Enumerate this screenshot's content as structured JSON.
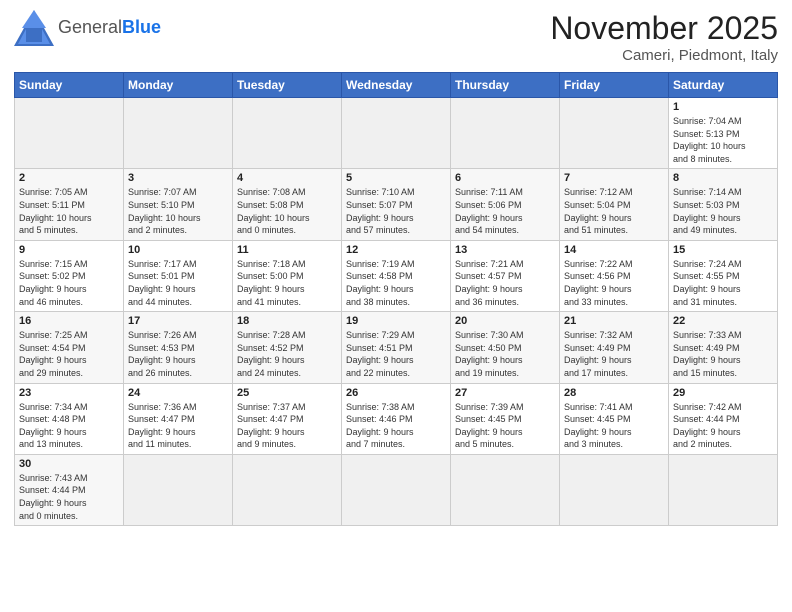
{
  "header": {
    "logo_text_general": "General",
    "logo_text_blue": "Blue",
    "title": "November 2025",
    "location": "Cameri, Piedmont, Italy"
  },
  "weekdays": [
    "Sunday",
    "Monday",
    "Tuesday",
    "Wednesday",
    "Thursday",
    "Friday",
    "Saturday"
  ],
  "weeks": [
    [
      {
        "day": "",
        "info": ""
      },
      {
        "day": "",
        "info": ""
      },
      {
        "day": "",
        "info": ""
      },
      {
        "day": "",
        "info": ""
      },
      {
        "day": "",
        "info": ""
      },
      {
        "day": "",
        "info": ""
      },
      {
        "day": "1",
        "info": "Sunrise: 7:04 AM\nSunset: 5:13 PM\nDaylight: 10 hours\nand 8 minutes."
      }
    ],
    [
      {
        "day": "2",
        "info": "Sunrise: 7:05 AM\nSunset: 5:11 PM\nDaylight: 10 hours\nand 5 minutes."
      },
      {
        "day": "3",
        "info": "Sunrise: 7:07 AM\nSunset: 5:10 PM\nDaylight: 10 hours\nand 2 minutes."
      },
      {
        "day": "4",
        "info": "Sunrise: 7:08 AM\nSunset: 5:08 PM\nDaylight: 10 hours\nand 0 minutes."
      },
      {
        "day": "5",
        "info": "Sunrise: 7:10 AM\nSunset: 5:07 PM\nDaylight: 9 hours\nand 57 minutes."
      },
      {
        "day": "6",
        "info": "Sunrise: 7:11 AM\nSunset: 5:06 PM\nDaylight: 9 hours\nand 54 minutes."
      },
      {
        "day": "7",
        "info": "Sunrise: 7:12 AM\nSunset: 5:04 PM\nDaylight: 9 hours\nand 51 minutes."
      },
      {
        "day": "8",
        "info": "Sunrise: 7:14 AM\nSunset: 5:03 PM\nDaylight: 9 hours\nand 49 minutes."
      }
    ],
    [
      {
        "day": "9",
        "info": "Sunrise: 7:15 AM\nSunset: 5:02 PM\nDaylight: 9 hours\nand 46 minutes."
      },
      {
        "day": "10",
        "info": "Sunrise: 7:17 AM\nSunset: 5:01 PM\nDaylight: 9 hours\nand 44 minutes."
      },
      {
        "day": "11",
        "info": "Sunrise: 7:18 AM\nSunset: 5:00 PM\nDaylight: 9 hours\nand 41 minutes."
      },
      {
        "day": "12",
        "info": "Sunrise: 7:19 AM\nSunset: 4:58 PM\nDaylight: 9 hours\nand 38 minutes."
      },
      {
        "day": "13",
        "info": "Sunrise: 7:21 AM\nSunset: 4:57 PM\nDaylight: 9 hours\nand 36 minutes."
      },
      {
        "day": "14",
        "info": "Sunrise: 7:22 AM\nSunset: 4:56 PM\nDaylight: 9 hours\nand 33 minutes."
      },
      {
        "day": "15",
        "info": "Sunrise: 7:24 AM\nSunset: 4:55 PM\nDaylight: 9 hours\nand 31 minutes."
      }
    ],
    [
      {
        "day": "16",
        "info": "Sunrise: 7:25 AM\nSunset: 4:54 PM\nDaylight: 9 hours\nand 29 minutes."
      },
      {
        "day": "17",
        "info": "Sunrise: 7:26 AM\nSunset: 4:53 PM\nDaylight: 9 hours\nand 26 minutes."
      },
      {
        "day": "18",
        "info": "Sunrise: 7:28 AM\nSunset: 4:52 PM\nDaylight: 9 hours\nand 24 minutes."
      },
      {
        "day": "19",
        "info": "Sunrise: 7:29 AM\nSunset: 4:51 PM\nDaylight: 9 hours\nand 22 minutes."
      },
      {
        "day": "20",
        "info": "Sunrise: 7:30 AM\nSunset: 4:50 PM\nDaylight: 9 hours\nand 19 minutes."
      },
      {
        "day": "21",
        "info": "Sunrise: 7:32 AM\nSunset: 4:49 PM\nDaylight: 9 hours\nand 17 minutes."
      },
      {
        "day": "22",
        "info": "Sunrise: 7:33 AM\nSunset: 4:49 PM\nDaylight: 9 hours\nand 15 minutes."
      }
    ],
    [
      {
        "day": "23",
        "info": "Sunrise: 7:34 AM\nSunset: 4:48 PM\nDaylight: 9 hours\nand 13 minutes."
      },
      {
        "day": "24",
        "info": "Sunrise: 7:36 AM\nSunset: 4:47 PM\nDaylight: 9 hours\nand 11 minutes."
      },
      {
        "day": "25",
        "info": "Sunrise: 7:37 AM\nSunset: 4:47 PM\nDaylight: 9 hours\nand 9 minutes."
      },
      {
        "day": "26",
        "info": "Sunrise: 7:38 AM\nSunset: 4:46 PM\nDaylight: 9 hours\nand 7 minutes."
      },
      {
        "day": "27",
        "info": "Sunrise: 7:39 AM\nSunset: 4:45 PM\nDaylight: 9 hours\nand 5 minutes."
      },
      {
        "day": "28",
        "info": "Sunrise: 7:41 AM\nSunset: 4:45 PM\nDaylight: 9 hours\nand 3 minutes."
      },
      {
        "day": "29",
        "info": "Sunrise: 7:42 AM\nSunset: 4:44 PM\nDaylight: 9 hours\nand 2 minutes."
      }
    ],
    [
      {
        "day": "30",
        "info": "Sunrise: 7:43 AM\nSunset: 4:44 PM\nDaylight: 9 hours\nand 0 minutes."
      },
      {
        "day": "",
        "info": ""
      },
      {
        "day": "",
        "info": ""
      },
      {
        "day": "",
        "info": ""
      },
      {
        "day": "",
        "info": ""
      },
      {
        "day": "",
        "info": ""
      },
      {
        "day": "",
        "info": ""
      }
    ]
  ]
}
